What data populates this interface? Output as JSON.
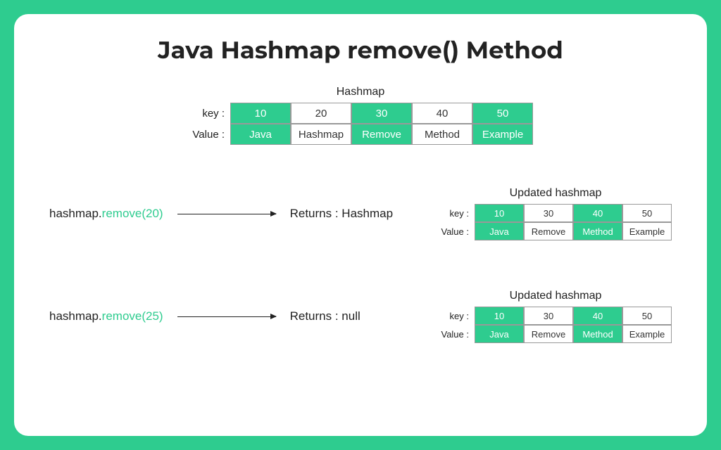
{
  "title": "Java Hashmap remove() Method",
  "topTable": {
    "title": "Hashmap",
    "keyLabel": "key :",
    "valueLabel": "Value :",
    "cols": [
      {
        "key": "10",
        "value": "Java",
        "g": true
      },
      {
        "key": "20",
        "value": "Hashmap",
        "g": false
      },
      {
        "key": "30",
        "value": "Remove",
        "g": true
      },
      {
        "key": "40",
        "value": "Method",
        "g": false
      },
      {
        "key": "50",
        "value": "Example",
        "g": true
      }
    ]
  },
  "ex1": {
    "codePrefix": "hashmap.",
    "codeMethod": "remove(20)",
    "returns": "Returns : Hashmap",
    "tbl": {
      "title": "Updated hashmap",
      "keyLabel": "key :",
      "valueLabel": "Value :",
      "cols": [
        {
          "key": "10",
          "value": "Java",
          "g": true
        },
        {
          "key": "30",
          "value": "Remove",
          "g": false
        },
        {
          "key": "40",
          "value": "Method",
          "g": true
        },
        {
          "key": "50",
          "value": "Example",
          "g": false
        }
      ]
    }
  },
  "ex2": {
    "codePrefix": "hashmap.",
    "codeMethod": "remove(25)",
    "returns": "Returns : null",
    "tbl": {
      "title": "Updated hashmap",
      "keyLabel": "key :",
      "valueLabel": "Value :",
      "cols": [
        {
          "key": "10",
          "value": "Java",
          "g": true
        },
        {
          "key": "30",
          "value": "Remove",
          "g": false
        },
        {
          "key": "40",
          "value": "Method",
          "g": true
        },
        {
          "key": "50",
          "value": "Example",
          "g": false
        }
      ]
    }
  }
}
